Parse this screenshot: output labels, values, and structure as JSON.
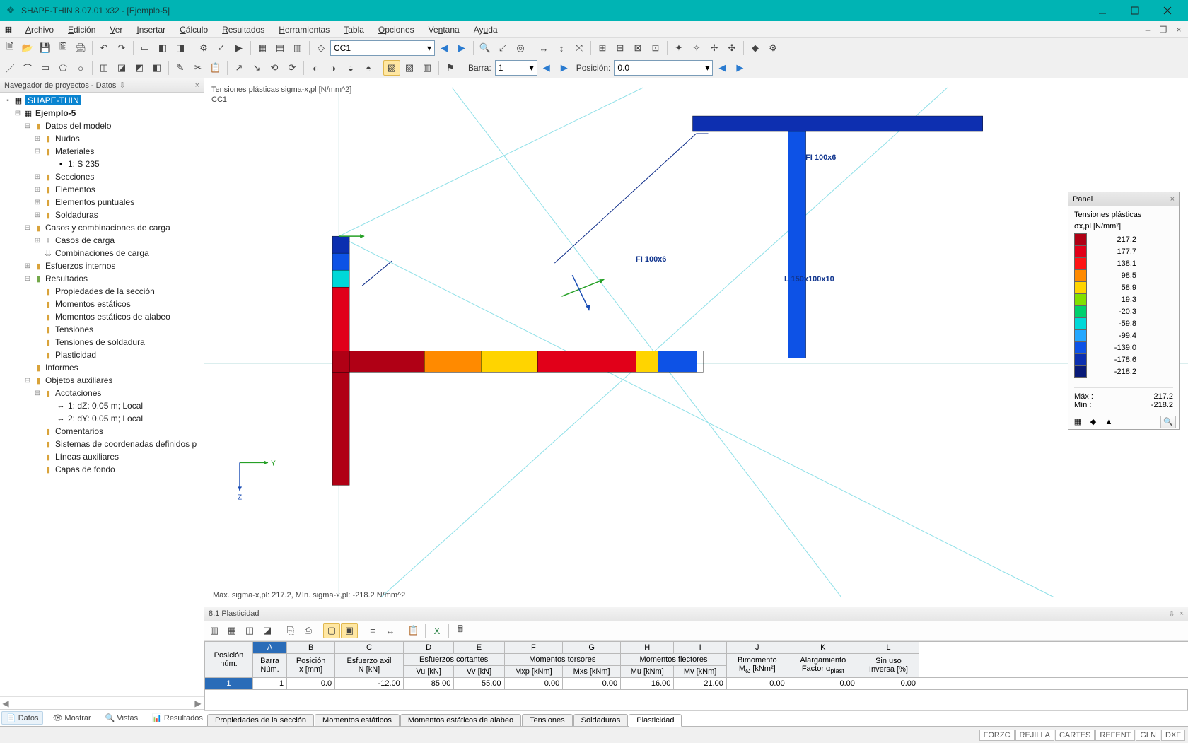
{
  "titlebar": {
    "text": "SHAPE-THIN 8.07.01 x32 - [Ejemplo-5]"
  },
  "menu": {
    "items": [
      "Archivo",
      "Edición",
      "Ver",
      "Insertar",
      "Cálculo",
      "Resultados",
      "Herramientas",
      "Tabla",
      "Opciones",
      "Ventana",
      "Ayuda"
    ]
  },
  "toolbar2": {
    "loadcase": "CC1",
    "barraLabel": "Barra:",
    "barraVal": "1",
    "posLabel": "Posición:",
    "posVal": "0.0"
  },
  "navigator": {
    "title": "Navegador de proyectos - Datos",
    "root": "SHAPE-THIN",
    "project": "Ejemplo-5",
    "nodes": {
      "datosModelo": "Datos del modelo",
      "nudos": "Nudos",
      "materiales": "Materiales",
      "mat1": "1: S 235",
      "secciones": "Secciones",
      "elementos": "Elementos",
      "elementosP": "Elementos puntuales",
      "soldaduras": "Soldaduras",
      "casosComb": "Casos y combinaciones de carga",
      "casosCarga": "Casos de carga",
      "combCarga": "Combinaciones de carga",
      "esfInt": "Esfuerzos internos",
      "resultados": "Resultados",
      "propSec": "Propiedades de la sección",
      "momEst": "Momentos estáticos",
      "momEstAl": "Momentos estáticos de alabeo",
      "tensiones": "Tensiones",
      "tenSold": "Tensiones de soldadura",
      "plast": "Plasticidad",
      "informes": "Informes",
      "objAux": "Objetos auxiliares",
      "acot": "Acotaciones",
      "ac1": "1: dZ: 0.05 m; Local",
      "ac2": "2: dY: 0.05 m; Local",
      "coment": "Comentarios",
      "sisCoord": "Sistemas de coordenadas definidos p",
      "linAux": "Líneas auxiliares",
      "capas": "Capas de fondo"
    },
    "tabs": [
      "Datos",
      "Mostrar",
      "Vistas",
      "Resultados"
    ]
  },
  "view": {
    "line1": "Tensiones plásticas sigma-x,pl [N/mm^2]",
    "line2": "CC1",
    "label1": "FI 100x6",
    "label2": "FI 100x6",
    "label3": "L 150x100x10",
    "bottom": "Máx. sigma-x,pl: 217.2, Mín. sigma-x,pl: -218.2 N/mm^2"
  },
  "legend": {
    "title": "Panel",
    "h1": "Tensiones plásticas",
    "h2": "σx,pl [N/mm²]",
    "scale": [
      {
        "c": "#b00015",
        "v": "217.2"
      },
      {
        "c": "#e10019",
        "v": "177.7"
      },
      {
        "c": "#ff1414",
        "v": "138.1"
      },
      {
        "c": "#ff8a00",
        "v": "98.5"
      },
      {
        "c": "#ffd400",
        "v": "58.9"
      },
      {
        "c": "#82e000",
        "v": "19.3"
      },
      {
        "c": "#00d06d",
        "v": "-20.3"
      },
      {
        "c": "#00d8d8",
        "v": "-59.8"
      },
      {
        "c": "#24a7ff",
        "v": "-99.4"
      },
      {
        "c": "#0d52e6",
        "v": "-139.0"
      },
      {
        "c": "#0b2fb0",
        "v": "-178.6"
      },
      {
        "c": "#081a78",
        "v": "-218.2"
      }
    ],
    "maxLabel": "Máx  :",
    "minLabel": "Mín  :",
    "max": "217.2",
    "min": "-218.2"
  },
  "table": {
    "title": "8.1 Plasticidad",
    "letters": [
      "A",
      "B",
      "C",
      "D",
      "E",
      "F",
      "G",
      "H",
      "I",
      "J",
      "K",
      "L"
    ],
    "group": {
      "pos": "Posición\nnúm.",
      "barra": "Barra\nNúm.",
      "posx": "Posición\nx [mm]",
      "axil": "Esfuerzo axil\nN [kN]",
      "cort": "Esfuerzos cortantes",
      "tors": "Momentos torsores",
      "flect": "Momentos flectores",
      "bimom": "Bimomento",
      "alarg": "Alargamiento",
      "sinuso": "Sin uso"
    },
    "sub": {
      "vu": "Vu [kN]",
      "vv": "Vv [kN]",
      "mxp": "Mxp [kNm]",
      "mxs": "Mxs [kNm]",
      "mu": "Mu [kNm]",
      "mv": "Mv [kNm]",
      "mw": "Mω [kNm²]",
      "factor": "Factor αplast",
      "inv": "Inversa [%]"
    },
    "row": {
      "n": "1",
      "barra": "1",
      "x": "0.0",
      "N": "-12.00",
      "Vu": "85.00",
      "Vv": "55.00",
      "Mxp": "0.00",
      "Mxs": "0.00",
      "Mu": "16.00",
      "Mv": "21.00",
      "Mw": "0.00",
      "f": "0.00",
      "inv": "0.00"
    },
    "tabs": [
      "Propiedades de la sección",
      "Momentos estáticos",
      "Momentos estáticos de alabeo",
      "Tensiones",
      "Soldaduras",
      "Plasticidad"
    ]
  },
  "status": {
    "cells": [
      "FORZC",
      "REJILLA",
      "CARTES",
      "REFENT",
      "GLN",
      "DXF"
    ]
  },
  "chart_data": {
    "type": "heatmap",
    "title": "Tensiones plásticas sigma-x,pl [N/mm^2]",
    "units": "N/mm²",
    "colorbar": {
      "min": -218.2,
      "max": 217.2,
      "stops": [
        217.2,
        177.7,
        138.1,
        98.5,
        58.9,
        19.3,
        -20.3,
        -59.8,
        -99.4,
        -139.0,
        -178.6,
        -218.2
      ]
    },
    "annotations": [
      "FI 100x6",
      "FI 100x6",
      "L 150x100x10"
    ],
    "stats": {
      "max": 217.2,
      "min": -218.2
    }
  }
}
